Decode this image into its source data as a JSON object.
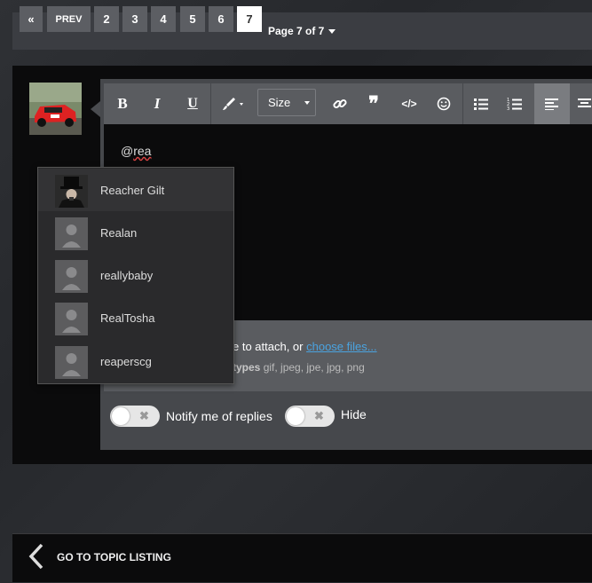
{
  "pagination": {
    "first_label": "«",
    "prev_label": "PREV",
    "pages": [
      "2",
      "3",
      "4",
      "5",
      "6",
      "7"
    ],
    "active_page": "7",
    "page_of_label": "Page 7 of 7"
  },
  "editor": {
    "toolbar": {
      "bold": "B",
      "italic": "I",
      "underline": "U",
      "size_label": "Size"
    },
    "typed_prefix": "@",
    "typed_word": "rea",
    "attach": {
      "prefix_text": "e to attach, or ",
      "link_text": "choose files...",
      "types_label": "types",
      "types_values": " gif, jpeg, jpe, jpg, png"
    },
    "notify_label": "Notify me of replies",
    "hide_label": "Hide"
  },
  "mention_suggestions": [
    {
      "name": "Reacher Gilt",
      "selected": true
    },
    {
      "name": "Realan",
      "selected": false
    },
    {
      "name": "reallybaby",
      "selected": false
    },
    {
      "name": "RealTosha",
      "selected": false
    },
    {
      "name": "reaperscg",
      "selected": false
    }
  ],
  "footer": {
    "go_to_topic_label": "GO TO TOPIC LISTING"
  },
  "colors": {
    "active_page_bg": "#ffffff",
    "link": "#4aa3e0",
    "toolbar_bg": "#5a5c60"
  }
}
